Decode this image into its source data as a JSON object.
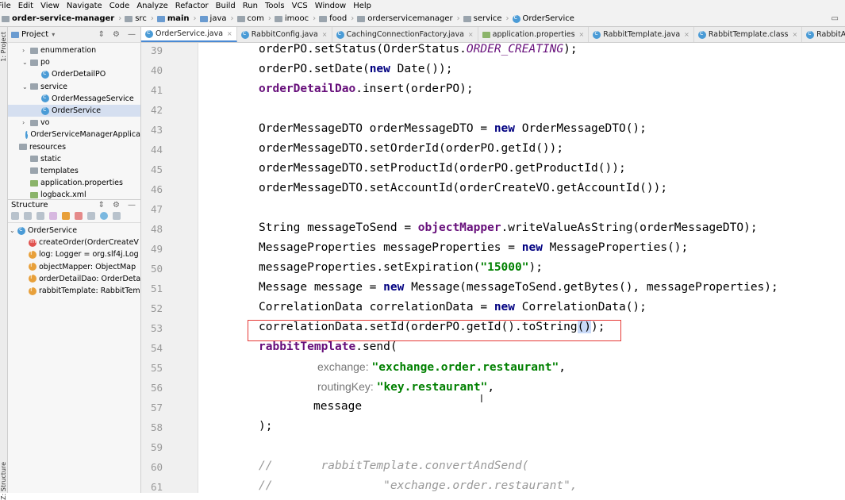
{
  "menu": [
    "File",
    "Edit",
    "View",
    "Navigate",
    "Code",
    "Analyze",
    "Refactor",
    "Build",
    "Run",
    "Tools",
    "VCS",
    "Window",
    "Help"
  ],
  "breadcrumbs": [
    "order-service-manager",
    "src",
    "main",
    "java",
    "com",
    "imooc",
    "food",
    "orderservicemanager",
    "service",
    "OrderService"
  ],
  "side_labels": {
    "project": "1: Project",
    "structure": "Z: Structure"
  },
  "project_panel": {
    "title": "Project",
    "items": [
      {
        "label": "enummeration",
        "type": "folder",
        "indent": 1,
        "arrow": "›"
      },
      {
        "label": "po",
        "type": "folder",
        "indent": 1,
        "arrow": "⌄"
      },
      {
        "label": "OrderDetailPO",
        "type": "class",
        "indent": 2,
        "arrow": ""
      },
      {
        "label": "service",
        "type": "folder",
        "indent": 1,
        "arrow": "⌄"
      },
      {
        "label": "OrderMessageService",
        "type": "class",
        "indent": 2,
        "arrow": ""
      },
      {
        "label": "OrderService",
        "type": "class",
        "indent": 2,
        "arrow": "",
        "selected": true
      },
      {
        "label": "vo",
        "type": "folder",
        "indent": 1,
        "arrow": "›"
      },
      {
        "label": "OrderServiceManagerApplica",
        "type": "class",
        "indent": 1,
        "arrow": ""
      },
      {
        "label": "resources",
        "type": "folder",
        "indent": 0,
        "arrow": ""
      },
      {
        "label": "static",
        "type": "folder",
        "indent": 1,
        "arrow": ""
      },
      {
        "label": "templates",
        "type": "folder",
        "indent": 1,
        "arrow": ""
      },
      {
        "label": "application.properties",
        "type": "file",
        "indent": 1,
        "arrow": ""
      },
      {
        "label": "logback.xml",
        "type": "file",
        "indent": 1,
        "arrow": ""
      }
    ]
  },
  "structure_panel": {
    "title": "Structure",
    "root": "OrderService",
    "items": [
      {
        "label": "createOrder(OrderCreateV",
        "kind": "m"
      },
      {
        "label": "log: Logger = org.slf4j.Log",
        "kind": "f"
      },
      {
        "label": "objectMapper: ObjectMap",
        "kind": "f"
      },
      {
        "label": "orderDetailDao: OrderDeta",
        "kind": "f"
      },
      {
        "label": "rabbitTemplate: RabbitTem",
        "kind": "f"
      }
    ]
  },
  "tabs": [
    {
      "label": "OrderService.java",
      "active": true
    },
    {
      "label": "RabbitConfig.java",
      "active": false
    },
    {
      "label": "CachingConnectionFactory.java",
      "active": false
    },
    {
      "label": "application.properties",
      "active": false
    },
    {
      "label": "RabbitTemplate.java",
      "active": false
    },
    {
      "label": "RabbitTemplate.class",
      "active": false
    },
    {
      "label": "RabbitAccessor.java",
      "active": false
    }
  ],
  "editor": {
    "line_numbers": [
      "39",
      "40",
      "41",
      "42",
      "43",
      "44",
      "45",
      "46",
      "47",
      "48",
      "49",
      "50",
      "51",
      "52",
      "53",
      "54",
      "55",
      "56",
      "57",
      "58",
      "59",
      "60",
      "61"
    ],
    "highlighted_line": "53",
    "colors": {
      "keyword": "#000080",
      "field": "#660e7a",
      "string": "#008000",
      "highlight_border": "#e53935"
    }
  }
}
